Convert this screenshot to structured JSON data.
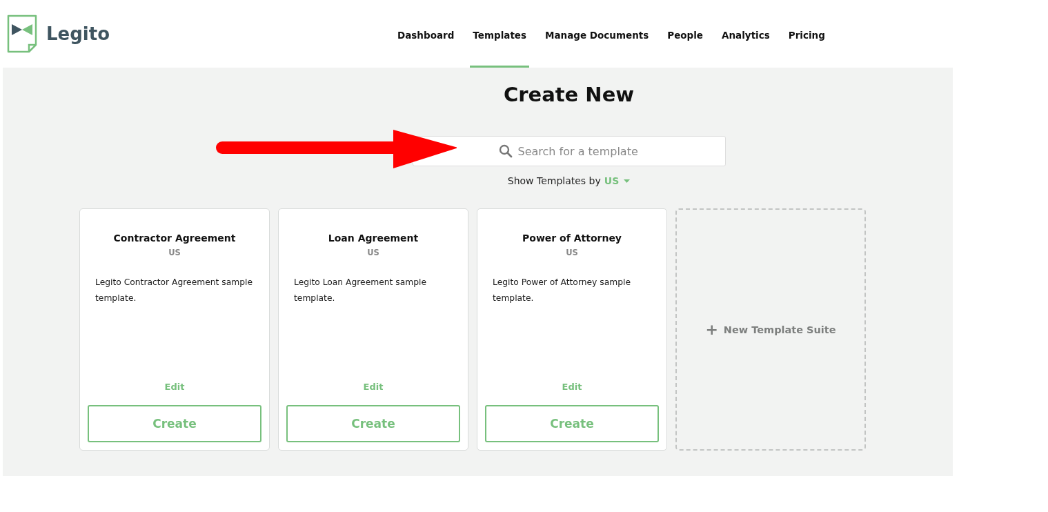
{
  "logo": {
    "text": "Legito"
  },
  "nav": [
    {
      "label": "Dashboard",
      "selected": false
    },
    {
      "label": "Templates",
      "selected": true
    },
    {
      "label": "Manage Documents",
      "selected": false
    },
    {
      "label": "People",
      "selected": false
    },
    {
      "label": "Analytics",
      "selected": false
    },
    {
      "label": "Pricing",
      "selected": false
    }
  ],
  "heading": "Create New",
  "search": {
    "placeholder": "Search for a template"
  },
  "filter": {
    "label": "Show Templates by",
    "value": "US"
  },
  "cards": [
    {
      "title": "Contractor Agreement",
      "region": "US",
      "description": "Legito Contractor Agreement sample template.",
      "edit": "Edit",
      "create": "Create"
    },
    {
      "title": "Loan Agreement",
      "region": "US",
      "description": "Legito Loan Agreement sample template.",
      "edit": "Edit",
      "create": "Create"
    },
    {
      "title": "Power of Attorney",
      "region": "US",
      "description": "Legito Power of Attorney sample template.",
      "edit": "Edit",
      "create": "Create"
    }
  ],
  "new_suite": {
    "icon": "+",
    "label": "New Template Suite"
  }
}
